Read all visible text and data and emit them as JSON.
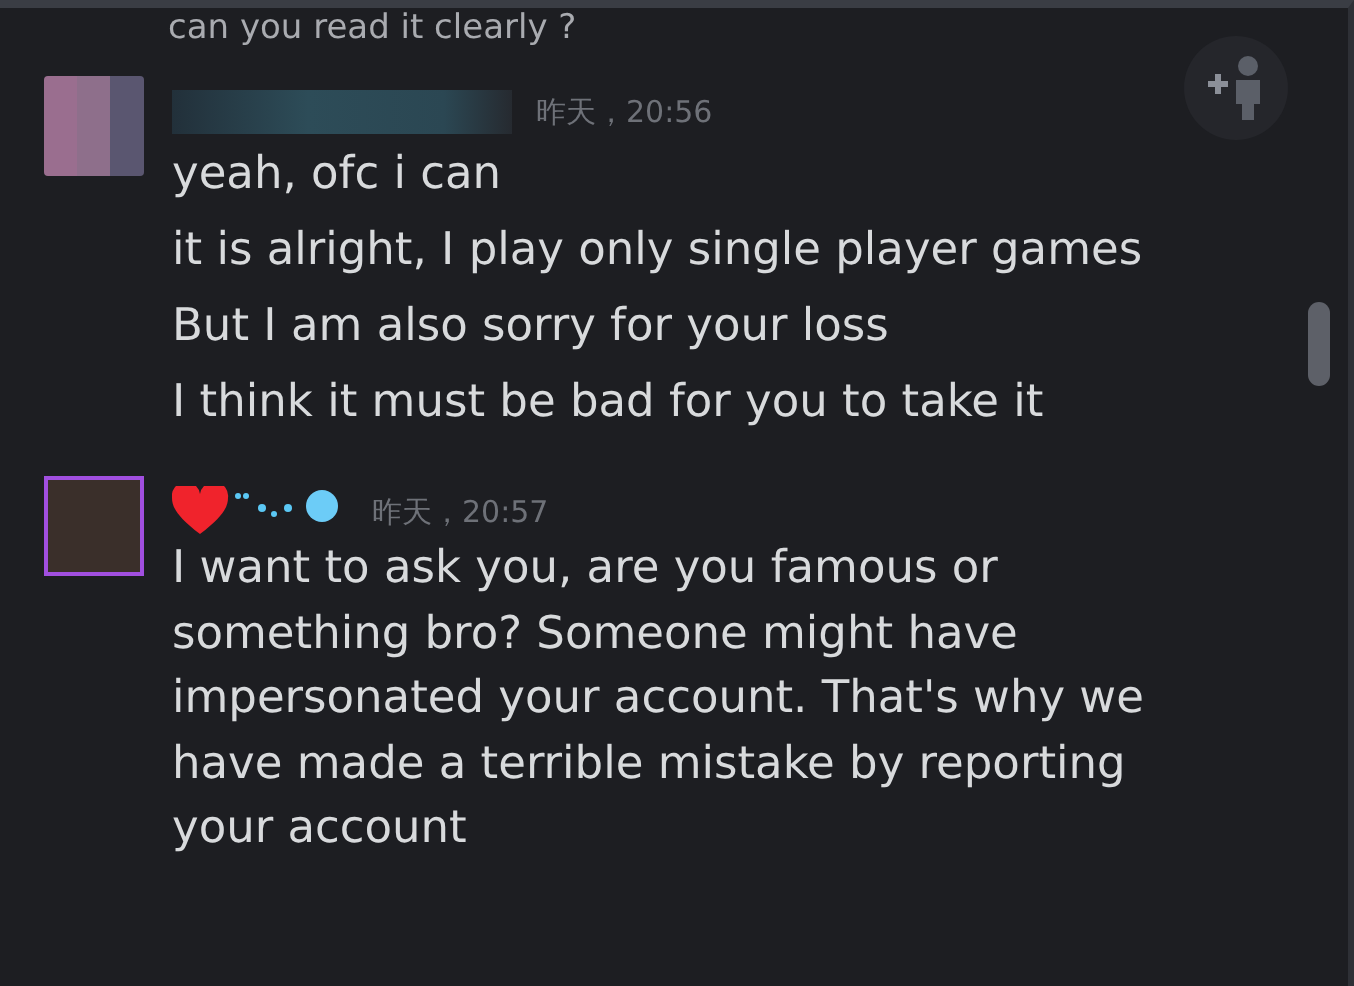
{
  "top_line": "can you read it clearly ?",
  "messages": [
    {
      "kind": "blurred",
      "time": "昨天，20:56",
      "lines": [
        "yeah, ofc i can",
        "it is alright, I play only single player games",
        "But I am also sorry for your loss",
        "I think it must be bad for you to take it"
      ]
    },
    {
      "kind": "decorated",
      "time": "昨天，20:57",
      "lines": [
        "I want to ask you, are you famous or something bro? Someone might have impersonated your account. That's why we have made a terrible mistake by reporting your account"
      ]
    }
  ]
}
